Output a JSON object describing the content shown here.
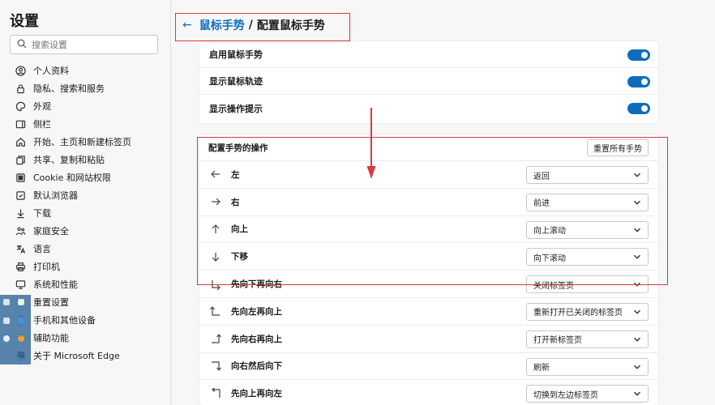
{
  "sidebar": {
    "title": "设置",
    "search_placeholder": "搜索设置",
    "items": [
      {
        "label": "个人资料",
        "icon": "profile-icon"
      },
      {
        "label": "隐私、搜索和服务",
        "icon": "lock-icon"
      },
      {
        "label": "外观",
        "icon": "palette-icon"
      },
      {
        "label": "侧栏",
        "icon": "sidebar-icon"
      },
      {
        "label": "开始、主页和新建标签页",
        "icon": "home-icon"
      },
      {
        "label": "共享、复制和粘贴",
        "icon": "share-icon"
      },
      {
        "label": "Cookie 和网站权限",
        "icon": "cookie-icon"
      },
      {
        "label": "默认浏览器",
        "icon": "browser-icon"
      },
      {
        "label": "下载",
        "icon": "download-icon"
      },
      {
        "label": "家庭安全",
        "icon": "family-icon"
      },
      {
        "label": "语言",
        "icon": "language-icon"
      },
      {
        "label": "打印机",
        "icon": "printer-icon"
      },
      {
        "label": "系统和性能",
        "icon": "system-icon"
      },
      {
        "label": "重置设置",
        "icon": "reset-icon"
      },
      {
        "label": "手机和其他设备",
        "icon": "phone-icon"
      },
      {
        "label": "辅助功能",
        "icon": "accessibility-icon"
      },
      {
        "label": "关于 Microsoft Edge",
        "icon": "edge-icon"
      }
    ]
  },
  "header": {
    "back_icon": "back-arrow-icon",
    "parent": "鼠标手势",
    "separator": "/",
    "current": "配置鼠标手势"
  },
  "toggles": [
    {
      "label": "启用鼠标手势",
      "on": true
    },
    {
      "label": "显示鼠标轨迹",
      "on": true
    },
    {
      "label": "显示操作提示",
      "on": true
    }
  ],
  "gestures": {
    "title": "配置手势的操作",
    "reset_label": "重置所有手势",
    "rows": [
      {
        "label": "左",
        "icon": "arrow-left-icon",
        "value": "返回"
      },
      {
        "label": "右",
        "icon": "arrow-right-icon",
        "value": "前进"
      },
      {
        "label": "向上",
        "icon": "arrow-up-icon",
        "value": "向上滚动"
      },
      {
        "label": "下移",
        "icon": "arrow-down-icon",
        "value": "向下滚动"
      },
      {
        "label": "先向下再向右",
        "icon": "down-right-icon",
        "value": "关闭标签页"
      },
      {
        "label": "先向左再向上",
        "icon": "left-up-icon",
        "value": "重新打开已关闭的标签页"
      },
      {
        "label": "先向右再向上",
        "icon": "right-up-icon",
        "value": "打开新标签页"
      },
      {
        "label": "向右然后向下",
        "icon": "right-down-icon",
        "value": "刷新"
      },
      {
        "label": "先向上再向左",
        "icon": "up-left-icon",
        "value": "切换到左边标签页"
      }
    ]
  },
  "colors": {
    "accent": "#0f6cbd",
    "annotation": "#d9393f"
  }
}
